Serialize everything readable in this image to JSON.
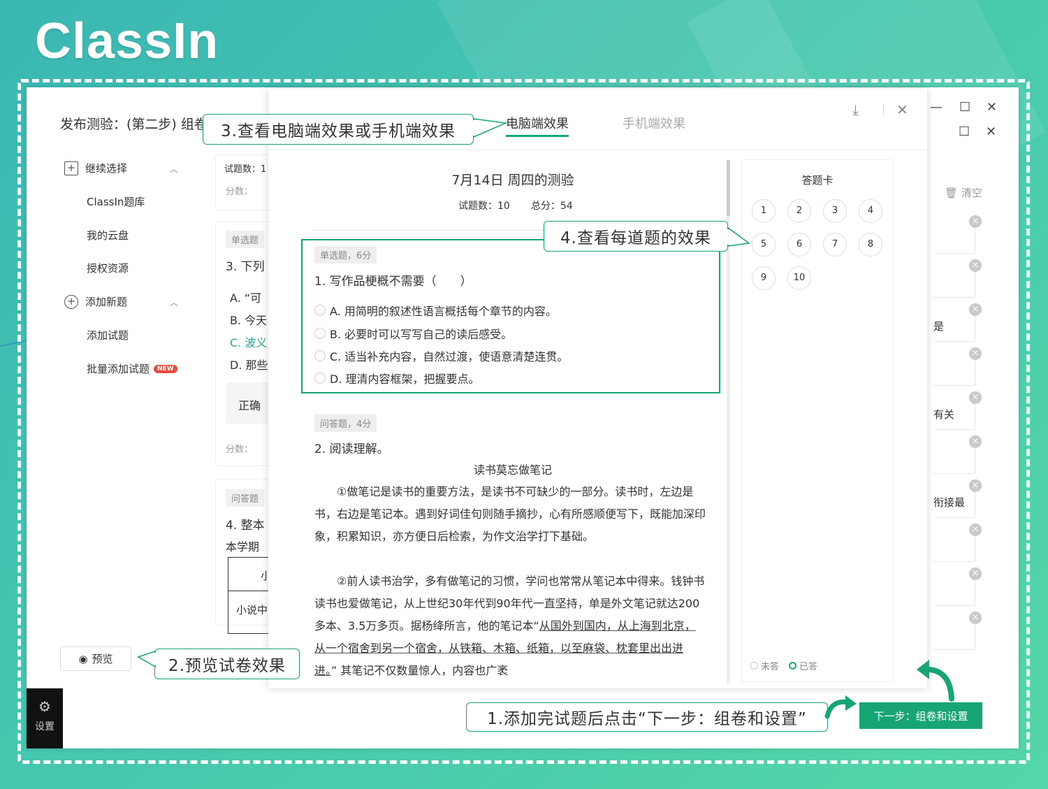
{
  "brand": {
    "logo_text": "ClassIn"
  },
  "back_window": {
    "page_title": "发布测验：(第二步) 组卷",
    "window_controls": {
      "minimize": "—",
      "maximize": "☐",
      "close": "✕"
    },
    "sidebar": {
      "sections": [
        {
          "label": "继续选择",
          "icon": "import-icon",
          "items": [
            "ClassIn题库",
            "我的云盘",
            "授权资源"
          ]
        },
        {
          "label": "添加新题",
          "icon": "add-circle-icon",
          "items": [
            "添加试题",
            "批量添加试题"
          ]
        }
      ],
      "new_badge": "NEW"
    },
    "middle": {
      "count_label": "试题数：1",
      "score_label": "分数：",
      "single_choice_tag": "单选题",
      "q3_text": "3. 下列",
      "opt_a": "A. “可",
      "opt_b": "B. 今天",
      "opt_c": "C. 波义",
      "opt_d": "D. 那些",
      "correct_label": "正确",
      "score_label2": "分数：",
      "essay_tag": "问答题",
      "q4_text": "4. 整本",
      "q4_sub": "本学期",
      "table_head": "小",
      "table_cell": "小说中"
    },
    "preview_button": "预览",
    "settings_label": "设置",
    "clear_label": "清空",
    "right_frag": {
      "r3": "是",
      "r5": "有关",
      "r7": "衔接最"
    },
    "next_button": "下一步：组卷和设置"
  },
  "preview_dialog": {
    "tabs": [
      {
        "label": "电脑端效果",
        "active": true
      },
      {
        "label": "手机端效果",
        "active": false
      }
    ],
    "exam": {
      "title": "7月14日 周四的测验",
      "count": "试题数：10",
      "total": "总分：54"
    },
    "q1": {
      "tag": "单选题，6分",
      "title": "1. 写作品梗概不需要（　　）",
      "options": [
        "A. 用简明的叙述性语言概括每个章节的内容。",
        "B. 必要时可以写写自己的读后感受。",
        "C. 适当补充内容，自然过渡，使语意清楚连贯。",
        "D. 理清内容框架，把握要点。"
      ]
    },
    "q2": {
      "tag": "问答题，4分",
      "title": "2. 阅读理解。",
      "passage_title": "读书莫忘做笔记",
      "para1": "①做笔记是读书的重要方法，是读书不可缺少的一部分。读书时，左边是书，右边是笔记本。遇到好词佳句则随手摘抄，心有所感顺便写下，既能加深印象，积累知识，亦方便日后检索，为作文治学打下基础。",
      "para2_plain": "②前人读书治学，多有做笔记的习惯，学问也常常从笔记本中得来。钱钟书读书也爱做笔记，从上世纪30年代到90年代一直坚持，单是外文笔记就达200多本、3.5万多页。据杨绛所言，他的笔记本“",
      "para2_underline": "从国外到国内，从上海到北京，从一个宿舍到另一个宿舍，从铁箱、木箱、纸箱，以至麻袋、枕套里出出进进。",
      "para2_tail": "” 其笔记不仅数量惊人，内容也广袤"
    },
    "answer_card": {
      "title": "答题卡",
      "numbers": [
        "1",
        "2",
        "3",
        "4",
        "5",
        "6",
        "7",
        "8",
        "9",
        "10"
      ],
      "legend_unanswered": "未答",
      "legend_answered": "已答"
    }
  },
  "callouts": {
    "step1": "1.添加完试题后点击“下一步：组卷和设置”",
    "step2": "2.预览试卷效果",
    "step3": "3.查看电脑端效果或手机端效果",
    "step4": "4.查看每道题的效果"
  },
  "colors": {
    "accent": "#17a673",
    "background": "#46c7ae",
    "badge": "#e94b3c"
  }
}
